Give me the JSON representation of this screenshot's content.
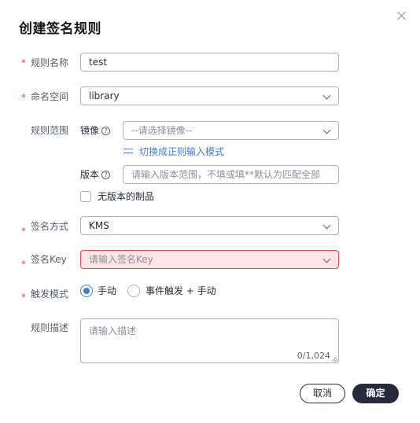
{
  "dialog": {
    "title": "创建签名规则"
  },
  "form": {
    "rule_name": {
      "label": "规则名称",
      "value": "test"
    },
    "namespace": {
      "label": "命名空间",
      "value": "library"
    },
    "scope": {
      "label": "规则范围",
      "image_label": "镜像",
      "image_placeholder": "--请选择镜像--",
      "regex_link": "切换成正则输入模式",
      "version_label": "版本",
      "version_placeholder": "请输入版本范围，不填或填**默认为匹配全部",
      "no_version_label": "无版本的制品"
    },
    "sign_method": {
      "label": "签名方式",
      "value": "KMS"
    },
    "sign_key": {
      "label": "签名Key",
      "placeholder": "请输入签名Key"
    },
    "trigger_mode": {
      "label": "触发模式",
      "options": [
        "手动",
        "事件触发 + 手动"
      ],
      "selected": "手动"
    },
    "description": {
      "label": "规则描述",
      "placeholder": "请输入描述",
      "counter": "0/1,024"
    },
    "required_mark": "*",
    "help_mark": "?"
  },
  "footer": {
    "cancel_label": "取消",
    "confirm_label": "确定"
  },
  "colors": {
    "accent": "#3d7cd4",
    "error": "#e34a4a",
    "error_bg": "#fde5e5",
    "primary_button": "#252b3a"
  }
}
